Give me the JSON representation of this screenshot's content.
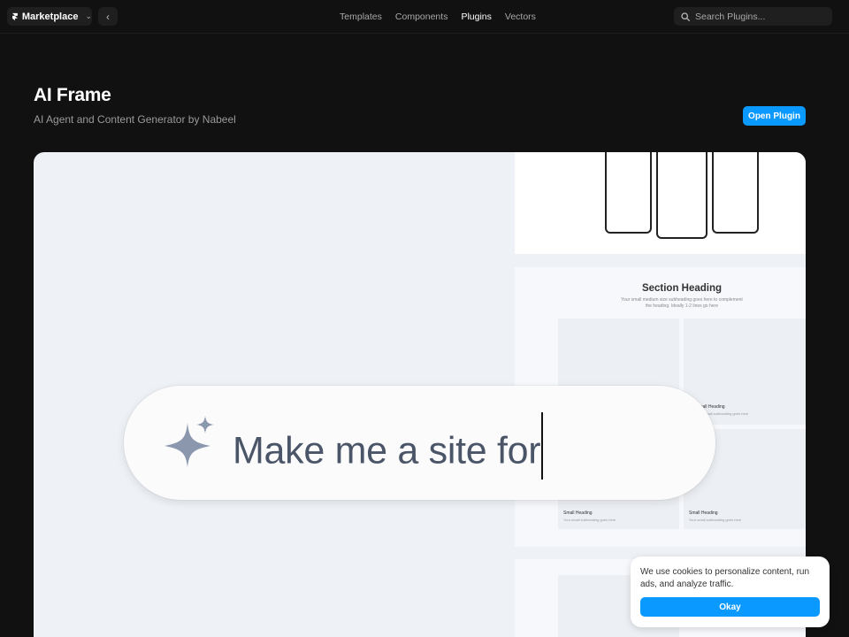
{
  "topnav": {
    "marketplace_label": "Marketplace",
    "links": [
      "Templates",
      "Components",
      "Plugins",
      "Vectors"
    ],
    "active_link": "Plugins",
    "search_placeholder": "Search Plugins..."
  },
  "header": {
    "title": "AI Frame",
    "subtitle": "AI Agent and Content Generator by Nabeel",
    "open_button": "Open Plugin"
  },
  "hero": {
    "prompt_text": "Make me a site for",
    "section_heading": "Section Heading",
    "section_sub": "Your small medium size subheading goes here to complement the heading. Ideally 1-2 lines go here",
    "cards": [
      {
        "label": "Small Heading",
        "sub": "Your small subheading goes here"
      },
      {
        "label": "Small Heading",
        "sub": "Your small subheading goes here"
      },
      {
        "label": "Small Heading",
        "sub": "Your small subheading goes here"
      }
    ]
  },
  "cookie": {
    "text": "We use cookies to personalize content, run ads, and analyze traffic.",
    "button": "Okay"
  },
  "colors": {
    "accent": "#0a99ff",
    "background": "#111111",
    "hero_bg": "#eef1f6"
  }
}
